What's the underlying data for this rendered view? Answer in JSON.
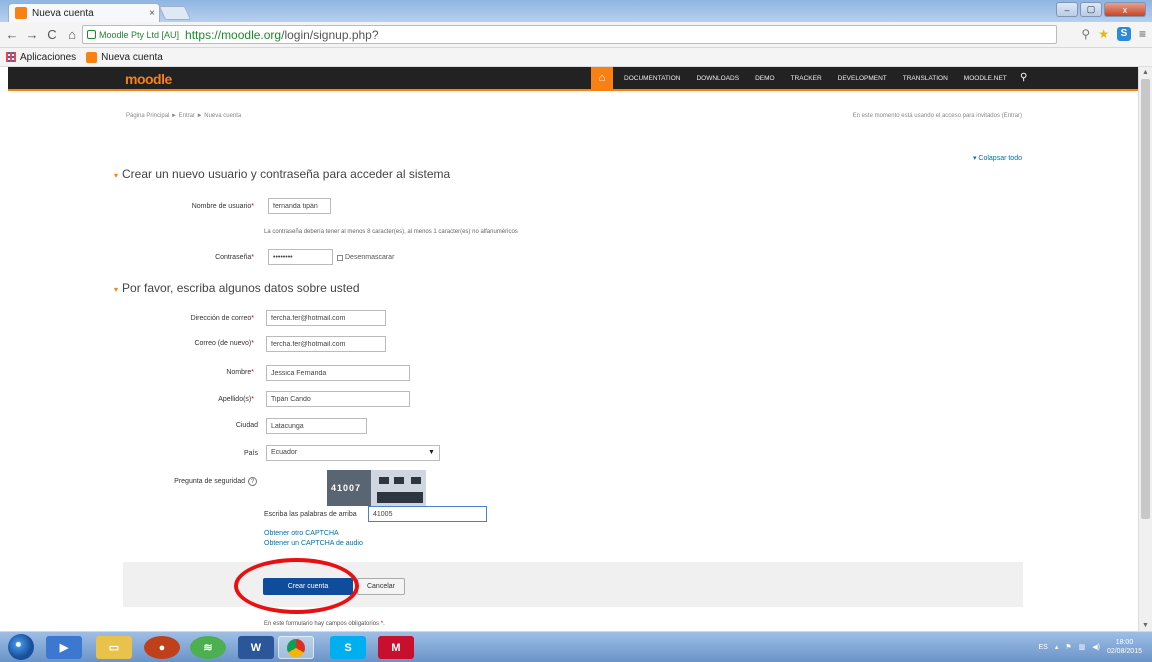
{
  "browser": {
    "tab_title": "Nueva cuenta",
    "tab_close": "×",
    "ev_label": "Moodle Pty Ltd [AU]",
    "url_host": "https://moodle.org",
    "url_path": "/login/signup.php?",
    "bookmarks": [
      "Aplicaciones",
      "Nueva cuenta"
    ],
    "window_buttons": [
      "–",
      "▢",
      "x"
    ]
  },
  "moodle": {
    "logo": "moodle",
    "nav": [
      "DOCUMENTATION",
      "DOWNLOADS",
      "DEMO",
      "TRACKER",
      "DEVELOPMENT",
      "TRANSLATION",
      "MOODLE.NET"
    ],
    "breadcrumb": "Página Principal ► Entrar ► Nueva cuenta",
    "guest_note": "En este momento está usando el acceso para invitados (Entrar)",
    "collapse_all": "Colapsar todo"
  },
  "form": {
    "section1_title": "Crear un nuevo usuario y contraseña para acceder al sistema",
    "username_label": "Nombre de usuario",
    "username_value": "fernanda tipán",
    "password_help": "La contraseña debería tener al menos 8 caracter(es), al menos 1 caracter(es) no alfanuméricos",
    "password_label": "Contraseña",
    "password_value": "••••••••",
    "unmask_label": "Desenmascarar",
    "section2_title": "Por favor, escriba algunos datos sobre usted",
    "email_label": "Dirección de correo",
    "email_value": "fercha.fer@hotmail.com",
    "email2_label": "Correo (de nuevo)",
    "email2_value": "fercha.fer@hotmail.com",
    "firstname_label": "Nombre",
    "firstname_value": "Jessica Fernanda",
    "lastname_label": "Apellido(s)",
    "lastname_value": "Tipán Cando",
    "city_label": "Ciudad",
    "city_value": "Latacunga",
    "country_label": "País",
    "country_value": "Ecuador",
    "captcha_label": "Pregunta de seguridad",
    "captcha_image_text": "41007",
    "captcha_input_label": "Escriba las palabras de arriba",
    "captcha_value": "41005",
    "captcha_link1": "Obtener otro CAPTCHA",
    "captcha_link2": "Obtener un CAPTCHA de audio",
    "submit_label": "Crear cuenta",
    "cancel_label": "Cancelar",
    "required_note": "En este formulario hay campos obligatorios"
  },
  "taskbar": {
    "clock_time": "18:00",
    "clock_date": "02/08/2015",
    "lang": "ES"
  },
  "colors": {
    "moodle_orange": "#f98012",
    "link_blue": "#0070a8",
    "annotation_red": "#e81010"
  }
}
